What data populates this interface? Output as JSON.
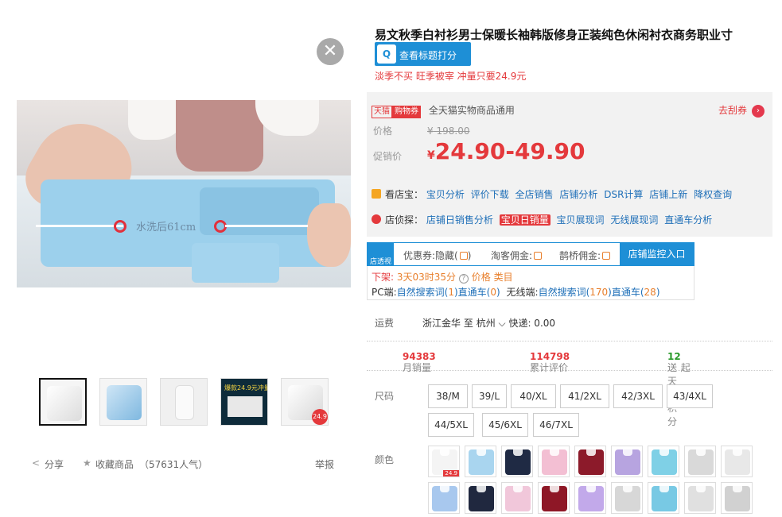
{
  "product": {
    "title": "易文秋季白衬衫男士保暖长袖韩版修身正装纯色休闲衬衣商务职业寸",
    "title_button": "查看标题打分",
    "promo_text": "淡季不买 旺季被宰 冲量只要24.9元"
  },
  "gallery": {
    "close_symbol": "✕",
    "measure_text": "水洗后61cm",
    "thumb_badge": "24.9",
    "thumb_banner_line1": "爆款24.9元冲量",
    "share_label": "分享",
    "collect_label": "收藏商品",
    "collect_count": "（57631人气）",
    "report_label": "举报"
  },
  "price": {
    "tmall_logo": "天猫",
    "tmall_tag": "购物券",
    "coupon_text": "全天猫实物商品通用",
    "go_coupon": "去刮券",
    "go_coupon_arrow": "›",
    "price_label": "价格",
    "currency": "¥",
    "old_price": "198.00",
    "promo_label": "促销价",
    "promo_price": "24.90-49.90"
  },
  "tools": {
    "row1_label": "看店宝：",
    "row1_links": [
      "宝贝分析",
      "评价下载",
      "全店销售",
      "店铺分析",
      "DSR计算",
      "店铺上新",
      "降权查询"
    ],
    "row2_label": "店侦探：",
    "row2_links": [
      "店铺日销售分析",
      "宝贝日销量",
      "宝贝展现词",
      "无线展现词",
      "直通车分析"
    ]
  },
  "plugin": {
    "logo_text": "店透视",
    "tab1": "优惠券:隐藏(",
    "tab1_end": ")",
    "tab2": "淘客佣金:",
    "tab3": "鹊桥佣金:",
    "tab_active": "店铺监控入口",
    "row1_prefix": "下架:",
    "row1_time": "3天03时35分",
    "row1_help": "?",
    "row1_price": "价格",
    "row1_cat": "类目",
    "row2_pc": "PC端:",
    "row2_search": "自然搜索词(",
    "row2_search_n": "1",
    "row2_ztc": ")直通车(",
    "row2_ztc_n": "0",
    "row2_close": ")",
    "row2_wireless": "无线端:",
    "row2_search2": "自然搜索词(",
    "row2_search2_n": "170",
    "row2_ztc2": ")直通车(",
    "row2_ztc2_n": "28",
    "row2_close2": ")"
  },
  "shipping": {
    "label": "运费",
    "from": "浙江金华",
    "to_word": "至",
    "to": "杭州",
    "method": "快递: 0.00"
  },
  "stats": {
    "monthly_label": "月销量",
    "monthly_value": "94383",
    "reviews_label": "累计评价",
    "reviews_value": "114798",
    "points_label": "送天猫积分",
    "points_value": "12",
    "points_suffix": "起"
  },
  "sizes": {
    "label": "尺码",
    "options": [
      "38/M",
      "39/L",
      "40/XL",
      "41/2XL",
      "42/3XL",
      "43/4XL",
      "44/5XL",
      "45/6XL",
      "46/7XL"
    ]
  },
  "colors": {
    "label": "颜色",
    "swatch_badge": "24.9",
    "swatches": [
      "#f4f4f4",
      "#a9d5ef",
      "#1f2a44",
      "#f3bfd3",
      "#8c1a2a",
      "#b7a4e0",
      "#7fd0e6",
      "#d9d9d9",
      "#e8e8e8",
      "#a8c8ee",
      "#20283f",
      "#f1c7da",
      "#8e1726",
      "#c2a9ea",
      "#d7d7d7",
      "#78c9e4",
      "#e0e0e0",
      "#d1d1d1"
    ]
  }
}
